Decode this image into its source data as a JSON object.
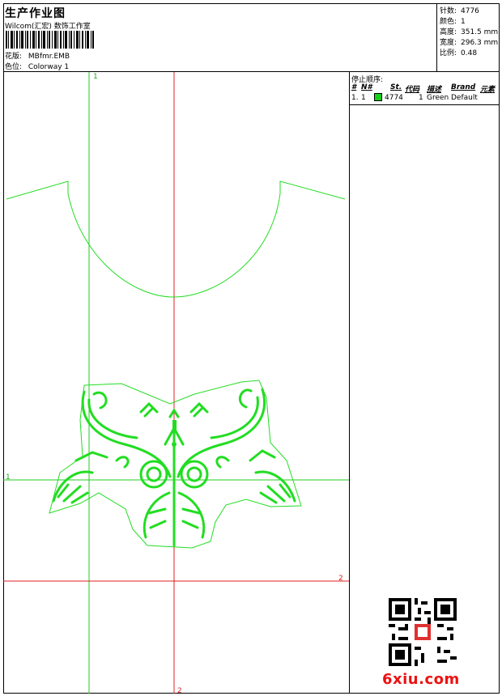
{
  "header": {
    "title": "生产作业图",
    "subtitle": "Wilcom(汇宏) 数饰工作室",
    "design_label": "花版:",
    "design_value": "MBfmr.EMB",
    "colorway_label": "色位:",
    "colorway_value": "Colorway 1"
  },
  "stats": {
    "stitches_label": "针数:",
    "stitches_value": "4776",
    "colors_label": "颜色:",
    "colors_value": "1",
    "height_label": "高度:",
    "height_value": "351.5 mm",
    "width_label": "宽度:",
    "width_value": "296.3 mm",
    "scale_label": "比例:",
    "scale_value": "0.48"
  },
  "canvas": {
    "marker_top_1": "1",
    "marker_left_1": "1",
    "marker_right_2": "2",
    "marker_bottom_2": "2"
  },
  "stop_sequence": {
    "title": "停止顺序:",
    "headers": {
      "num": "#",
      "needle": "N#",
      "stitches": "St.",
      "code": "代码",
      "description": "描述",
      "brand": "Brand",
      "elements": "元素"
    },
    "rows": [
      {
        "num": "1.",
        "needle": "1",
        "stitches": "4774",
        "code": "1",
        "description": "Green",
        "brand": "Default",
        "color": "#17d017"
      }
    ]
  },
  "footer": {
    "site": "6xiu.com",
    "qr": "qr-code-icon"
  },
  "colors": {
    "design_green": "#22dd22",
    "axis_red": "#e02020",
    "axis_green": "#22cc22"
  }
}
